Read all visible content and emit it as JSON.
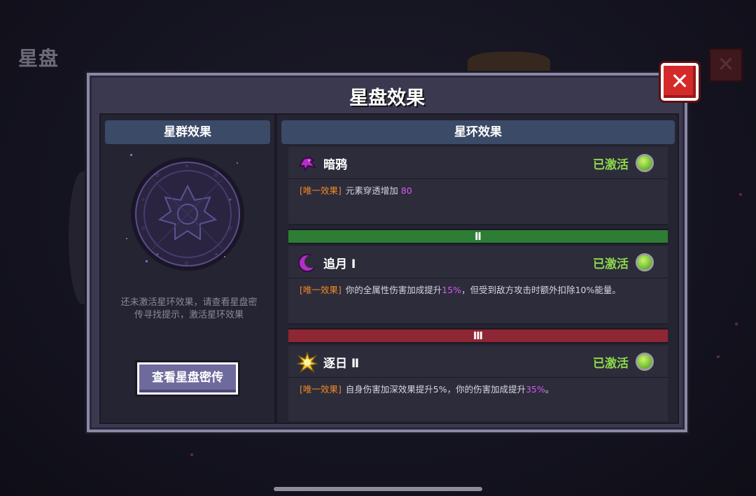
{
  "background": {
    "title": "星盘"
  },
  "modal": {
    "title": "星盘效果",
    "close_label": "✕"
  },
  "left_panel": {
    "header": "星群效果",
    "hint_line1": "还未激活星环效果，请查看星盘密",
    "hint_line2": "传寻找提示，激活星环效果",
    "lore_button": "查看星盘密传"
  },
  "right_panel": {
    "header": "星环效果",
    "effects": [
      {
        "name": "暗鸦",
        "icon": "raven-icon",
        "status": "已激活",
        "tag": "[唯一效果]",
        "desc_parts": [
          "元素穿透增加 ",
          "80",
          ""
        ]
      },
      {
        "name": "追月 Ⅰ",
        "icon": "crescent-moon-icon",
        "status": "已激活",
        "tag": "[唯一效果]",
        "desc_parts": [
          "你的全属性伤害加成提升",
          "15%",
          "，但受到敌方攻击时额外扣除10%能量。"
        ]
      },
      {
        "name": "逐日 Ⅱ",
        "icon": "sun-icon",
        "status": "已激活",
        "tag": "[唯一效果]",
        "desc_parts": [
          "自身伤害加深效果提升5%，你的伤害加成提升",
          "35%",
          "。"
        ]
      }
    ],
    "tiers": [
      "Ⅱ",
      "Ⅲ"
    ]
  },
  "colors": {
    "active_status": "#8cd84b",
    "unique_tag": "#f08a24",
    "highlight": "#d45cf0",
    "tier2": "#2e7d35",
    "tier3": "#8f2633",
    "close_button": "#d52a2a"
  }
}
